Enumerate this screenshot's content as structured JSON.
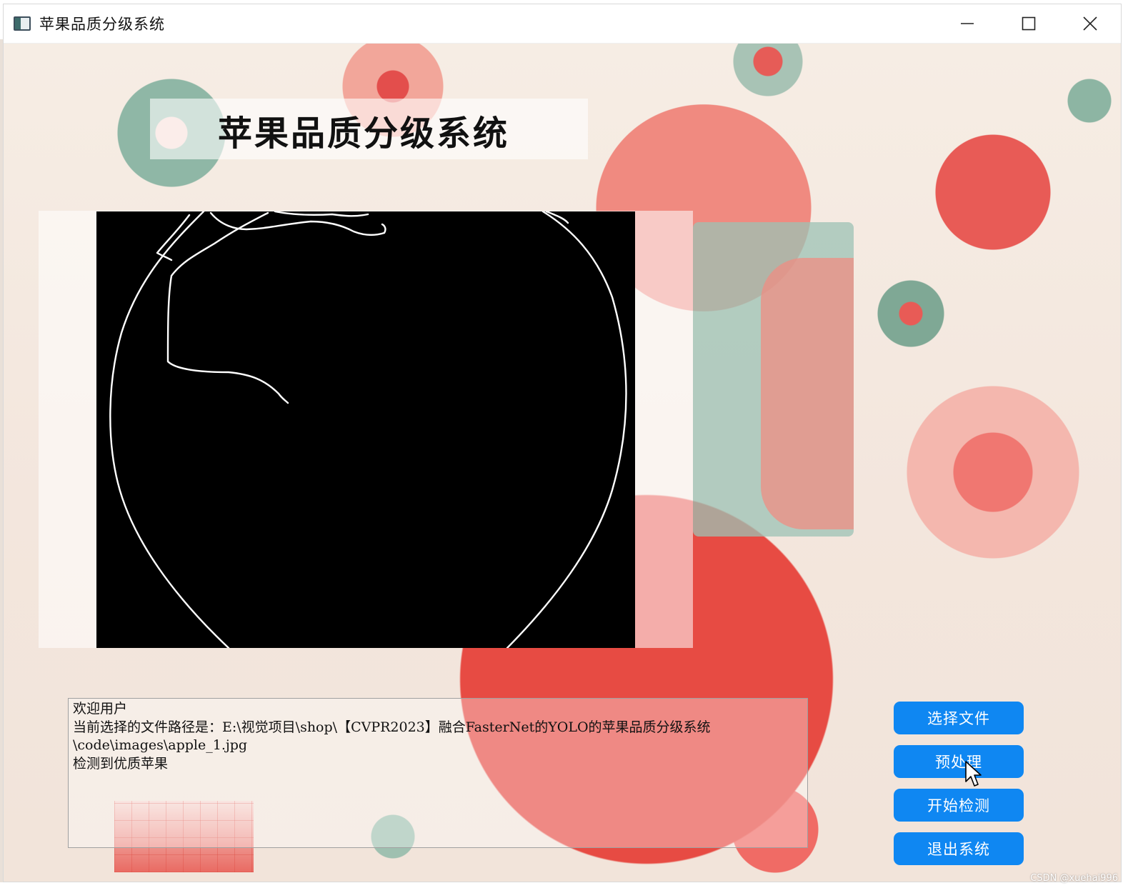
{
  "window": {
    "title": "苹果品质分级系统",
    "icon": "app-window-icon",
    "controls": [
      "minimize-icon",
      "maximize-icon",
      "close-icon"
    ]
  },
  "header": {
    "title": "苹果品质分级系统"
  },
  "image_view": {
    "content": "apple edge detection result (white contours on black)"
  },
  "log": {
    "lines": [
      "欢迎用户",
      "当前选择的文件路径是：E:\\视觉项目\\shop\\【CVPR2023】融合FasterNet的YOLO的苹果品质分级系统",
      "\\code\\images\\apple_1.jpg",
      "检测到优质苹果"
    ]
  },
  "buttons": {
    "select_file": "选择文件",
    "preprocess": "预处理",
    "start_detect": "开始检测",
    "exit": "退出系统"
  },
  "watermark": "CSDN @xuehai996",
  "colors": {
    "button_bg": "#0f87f2",
    "button_text": "#ffffff",
    "canvas_bg": "#000000",
    "edge_color": "#ffffff"
  }
}
